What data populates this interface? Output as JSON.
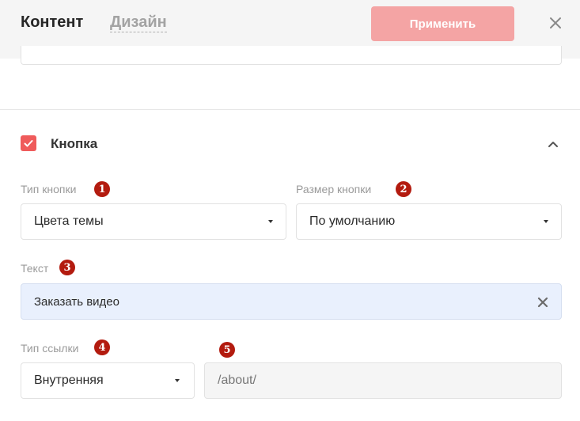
{
  "header": {
    "tabs": [
      {
        "label": "Контент",
        "active": true
      },
      {
        "label": "Дизайн",
        "active": false
      }
    ],
    "apply_label": "Применить",
    "close_icon": "close-icon"
  },
  "section": {
    "title": "Кнопка",
    "enabled": true,
    "collapse_icon": "chevron-up-icon"
  },
  "fields": {
    "button_type": {
      "label": "Тип кнопки",
      "badge": "1",
      "value": "Цвета темы"
    },
    "button_size": {
      "label": "Размер кнопки",
      "badge": "2",
      "value": "По умолчанию"
    },
    "text": {
      "label": "Текст",
      "badge": "3",
      "value": "Заказать видео"
    },
    "link_type": {
      "label": "Тип ссылки",
      "badge": "4",
      "value": "Внутренняя"
    },
    "url": {
      "badge": "5",
      "value": "/about/"
    }
  },
  "colors": {
    "accent": "#ef5b5b",
    "apply_button": "#f4a4a4",
    "badge": "#b31b0f",
    "text_field_bg": "#e9f0fd"
  }
}
